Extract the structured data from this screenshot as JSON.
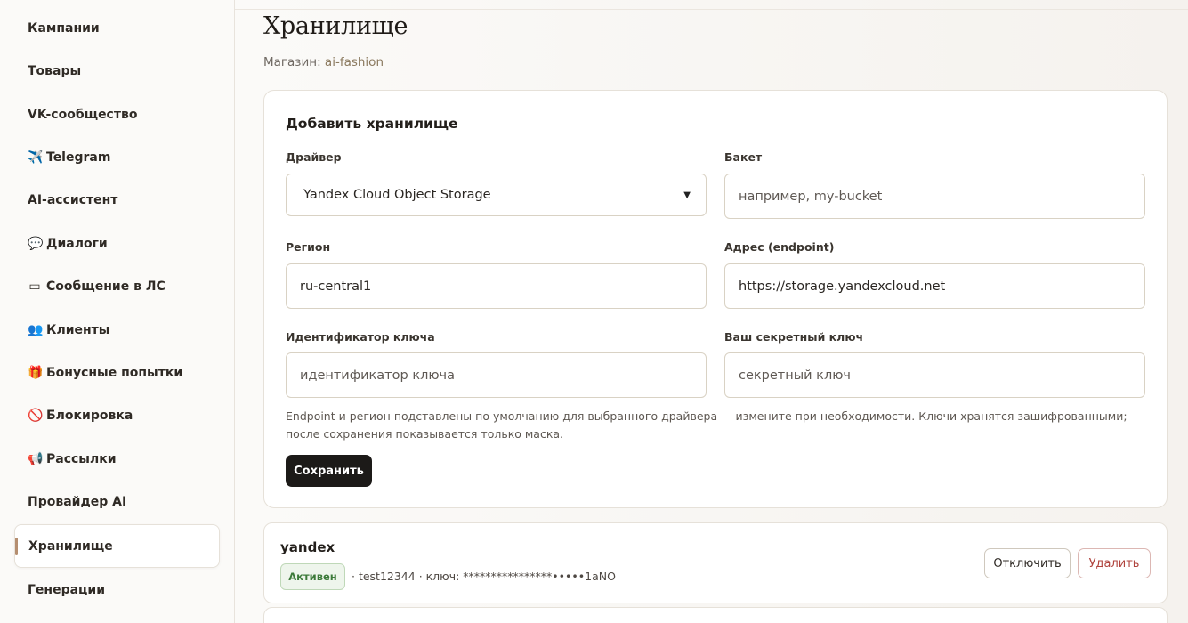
{
  "sidebar": {
    "items": [
      {
        "label": "Кампании",
        "icon": ""
      },
      {
        "label": "Товары",
        "icon": ""
      },
      {
        "label": "VK-сообщество",
        "icon": ""
      },
      {
        "label": "Telegram",
        "icon": "✈️"
      },
      {
        "label": "AI-ассистент",
        "icon": ""
      },
      {
        "label": "Диалоги",
        "icon": "💬"
      },
      {
        "label": "Сообщение в ЛС",
        "icon": "▭"
      },
      {
        "label": "Клиенты",
        "icon": "👥"
      },
      {
        "label": "Бонусные попытки",
        "icon": "🎁"
      },
      {
        "label": "Блокировка",
        "icon": "🚫"
      },
      {
        "label": "Рассылки",
        "icon": "📢"
      },
      {
        "label": "Провайдер AI",
        "icon": ""
      },
      {
        "label": "Хранилище",
        "icon": ""
      },
      {
        "label": "Генерации",
        "icon": ""
      }
    ],
    "active_index": 12
  },
  "header": {
    "title": "Хранилище",
    "store_label": "Магазин:",
    "store_name": "ai-fashion"
  },
  "form": {
    "title": "Добавить хранилище",
    "driver_label": "Драйвер",
    "driver_value": "Yandex Cloud Object Storage",
    "bucket_label": "Бакет",
    "bucket_placeholder": "например, my-bucket",
    "region_label": "Регион",
    "region_value": "ru-central1",
    "endpoint_label": "Адрес (endpoint)",
    "endpoint_value": "https://storage.yandexcloud.net",
    "key_id_label": "Идентификатор ключа",
    "key_id_placeholder": "идентификатор ключа",
    "secret_label": "Ваш секретный ключ",
    "secret_placeholder": "секретный ключ",
    "hint": "Endpoint и регион подставлены по умолчанию для выбранного драйвера — измените при необходимости. Ключи хранятся зашифрованными; после сохранения показывается только маска.",
    "save_label": "Сохранить"
  },
  "storages": [
    {
      "name": "yandex",
      "status": "Активен",
      "meta": "· test12344 · ключ: ****************•••••1aNO",
      "disable_label": "Отключить",
      "delete_label": "Удалить"
    }
  ],
  "colors": {
    "accent": "#b58e70",
    "primary_button": "#1c1a18",
    "active_status": "#3c7a3a",
    "danger": "#b0443e"
  }
}
